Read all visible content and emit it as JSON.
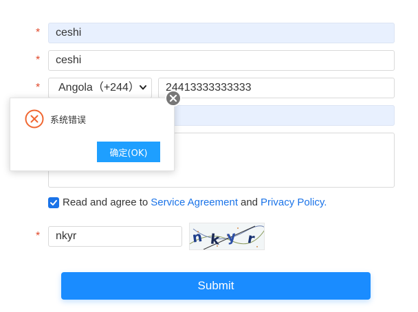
{
  "form": {
    "required_mark": "*",
    "username": {
      "value": "ceshi"
    },
    "nickname": {
      "value": "ceshi"
    },
    "country": {
      "selected": "Angola（+244）"
    },
    "phone": {
      "value": "24413333333333"
    },
    "email": {
      "value": ""
    },
    "address": {
      "value": ""
    },
    "agreement": {
      "checked": true,
      "prefix": "Read and agree to",
      "service_link": "Service Agreement",
      "and": "and",
      "privacy_link": "Privacy Policy."
    },
    "captcha": {
      "value": "nkyr"
    },
    "submit_label": "Submit"
  },
  "dialog": {
    "message": "系统错误",
    "ok_label": "确定(OK)"
  },
  "colors": {
    "accent": "#1a8cff",
    "link": "#1a73e8",
    "required": "#e0492c",
    "error_icon": "#f0652f",
    "dialog_button": "#1e9fff"
  },
  "icons": {
    "error": "circle-x-icon",
    "close": "close-circle-icon",
    "checkbox": "check-icon",
    "select": "chevron-down-icon"
  }
}
